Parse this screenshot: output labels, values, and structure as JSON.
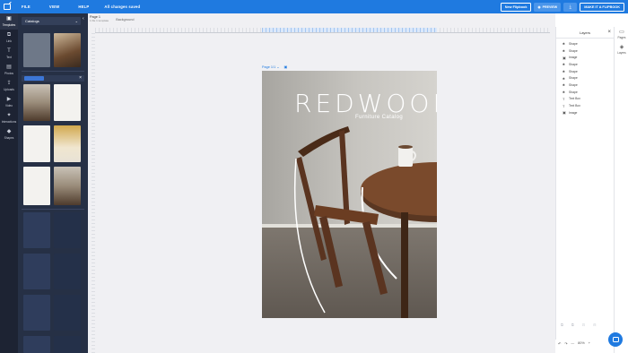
{
  "topbar": {
    "menu": [
      "FILE",
      "VIEW",
      "HELP"
    ],
    "saved_text": "All changes saved",
    "new_flipbook": "New Flipbook",
    "preview": "PREVIEW",
    "download_icon": "download-icon",
    "make_flipbook": "MAKE IT A FLIPBOOK",
    "brand_color": "#1f7ae0"
  },
  "rail": {
    "items": [
      {
        "label": "Templates",
        "icon": "templates-icon"
      },
      {
        "label": "Link",
        "icon": "link-icon"
      },
      {
        "label": "Text",
        "icon": "text-icon"
      },
      {
        "label": "Photos",
        "icon": "photos-icon"
      },
      {
        "label": "Uploads",
        "icon": "upload-icon"
      },
      {
        "label": "Video",
        "icon": "video-icon"
      },
      {
        "label": "Interactions",
        "icon": "interactions-icon"
      },
      {
        "label": "Shapes",
        "icon": "shapes-icon"
      }
    ]
  },
  "panel": {
    "category": "Catalogs"
  },
  "canvas": {
    "page_tab": "Page 1",
    "page_tab_sub": "1 file 1 template",
    "background_tab": "Background",
    "page_label": "Page 1/1"
  },
  "artboard": {
    "title": "REDWOOD",
    "subtitle": "Furniture Catalog"
  },
  "layers": {
    "title": "Layers",
    "items": [
      {
        "type": "shape",
        "label": "Shape"
      },
      {
        "type": "shape",
        "label": "Shape"
      },
      {
        "type": "image",
        "label": "Image"
      },
      {
        "type": "shape",
        "label": "Shape"
      },
      {
        "type": "shape",
        "label": "Shape"
      },
      {
        "type": "shape",
        "label": "Shape"
      },
      {
        "type": "shape",
        "label": "Shape"
      },
      {
        "type": "shape",
        "label": "Shape"
      },
      {
        "type": "text",
        "label": "Text Box"
      },
      {
        "type": "text",
        "label": "Text Box"
      },
      {
        "type": "image",
        "label": "Image"
      }
    ]
  },
  "right_sidebar": {
    "pages": "Pages",
    "layers": "Layers"
  },
  "zoom": {
    "value": "80%"
  }
}
